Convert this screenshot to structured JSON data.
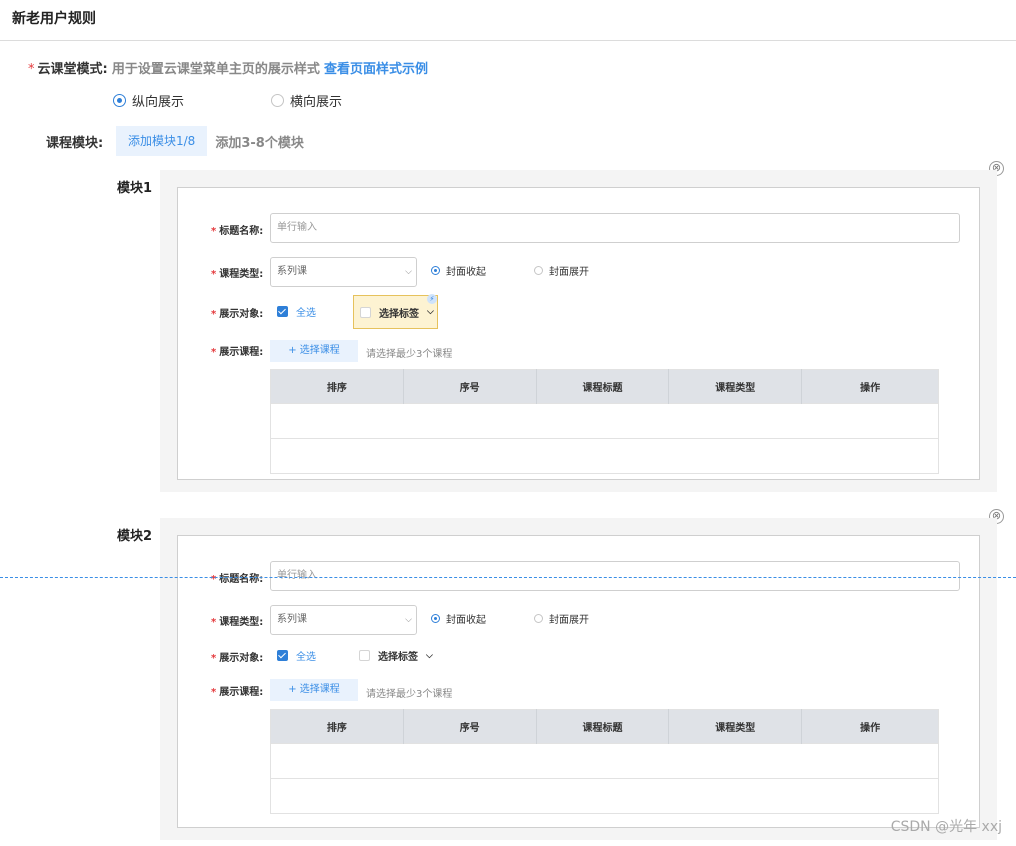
{
  "page": {
    "title": "新老用户规则"
  },
  "cloud_mode": {
    "required_mark": "*",
    "label": "云课堂模式:",
    "description": "用于设置云课堂菜单主页的展示样式",
    "link": "查看页面样式示例",
    "options": [
      {
        "label": "纵向展示",
        "selected": true
      },
      {
        "label": "横向展示",
        "selected": false
      }
    ]
  },
  "course_modules": {
    "label": "课程模块:",
    "add_button": "添加模块1/8",
    "hint": "添加3-8个模块"
  },
  "modules": [
    {
      "title": "模块1",
      "close_icon": "⊗",
      "fields": {
        "title_label": "标题名称:",
        "title_placeholder": "单行输入",
        "type_label": "课程类型:",
        "type_value": "系列课",
        "cover_collapse": "封面收起",
        "cover_expand": "封面展开",
        "target_label": "展示对象:",
        "select_all": "全选",
        "select_tags": "选择标签",
        "courses_label": "展示课程:",
        "choose_courses": "+ 选择课程",
        "choose_hint": "请选择最少3个课程"
      },
      "table_headers": [
        "排序",
        "序号",
        "课程标题",
        "课程类型",
        "操作"
      ]
    },
    {
      "title": "模块2",
      "close_icon": "⊗",
      "fields": {
        "title_label": "标题名称:",
        "title_placeholder": "单行输入",
        "type_label": "课程类型:",
        "type_value": "系列课",
        "cover_collapse": "封面收起",
        "cover_expand": "封面展开",
        "target_label": "展示对象:",
        "select_all": "全选",
        "select_tags": "选择标签",
        "courses_label": "展示课程:",
        "choose_courses": "+ 选择课程",
        "choose_hint": "请选择最少3个课程"
      },
      "table_headers": [
        "排序",
        "序号",
        "课程标题",
        "课程类型",
        "操作"
      ]
    }
  ],
  "watermark": "CSDN @光年 xxj",
  "colors": {
    "accent": "#3a8ee6",
    "required": "#e4393c",
    "highlight": "#fdf3d2"
  }
}
